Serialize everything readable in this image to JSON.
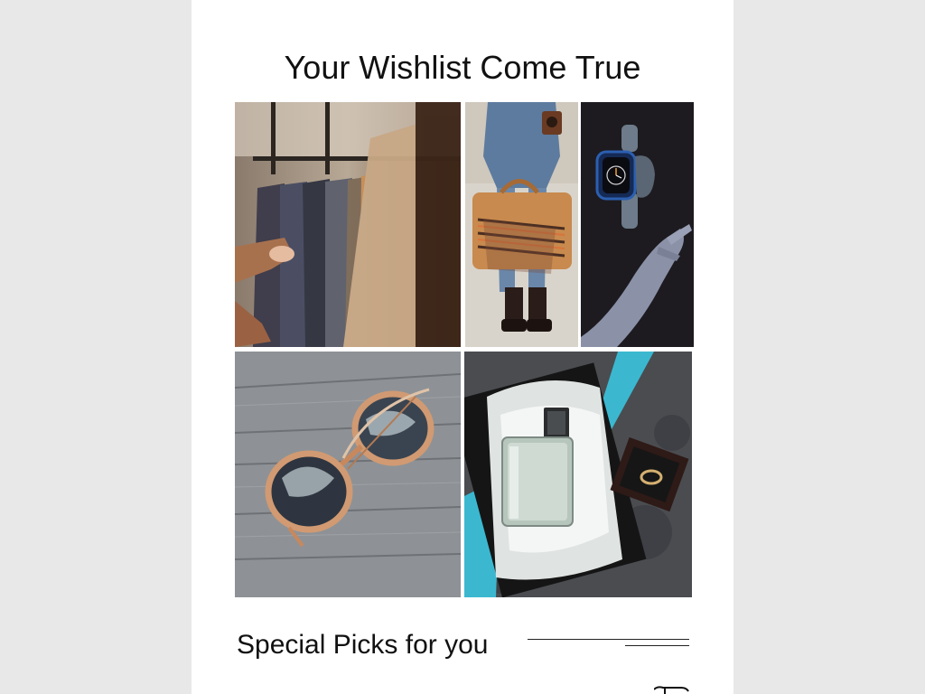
{
  "header": {
    "title": "Your Wishlist Come True"
  },
  "gallery": {
    "tiles": [
      {
        "name": "clothing-rack-photo",
        "icon": "clothes-rack-image"
      },
      {
        "name": "travel-bag-photo",
        "icon": "leather-bag-image"
      },
      {
        "name": "smartwatch-photo",
        "icon": "smartwatch-image"
      },
      {
        "name": "sunglasses-photo",
        "icon": "sunglasses-image"
      },
      {
        "name": "perfume-gift-photo",
        "icon": "perfume-box-image"
      }
    ]
  },
  "section": {
    "title": "Special Picks for you"
  },
  "colors": {
    "background": "#e8e8e8",
    "card": "#ffffff",
    "text": "#111111",
    "ribbon": "#3bb8d0"
  }
}
